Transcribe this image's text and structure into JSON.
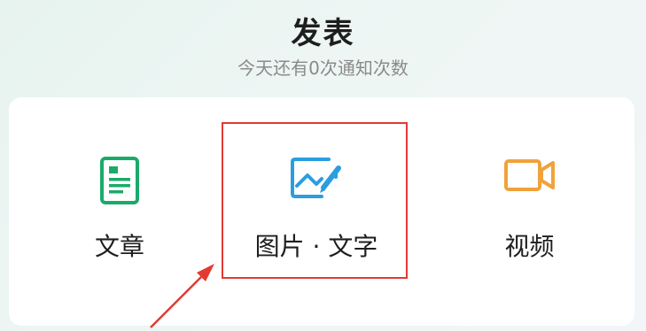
{
  "header": {
    "title": "发表",
    "subtitle": "今天还有0次通知次数"
  },
  "options": {
    "article": {
      "label": "文章",
      "icon": "document-icon",
      "color": "#1aaa6a"
    },
    "image_text": {
      "label": "图片 · 文字",
      "icon": "image-icon",
      "color": "#2a9ee0"
    },
    "video": {
      "label": "视频",
      "icon": "video-camera-icon",
      "color": "#f0a23c"
    }
  },
  "annotation": {
    "highlight_color": "#e23a33"
  }
}
